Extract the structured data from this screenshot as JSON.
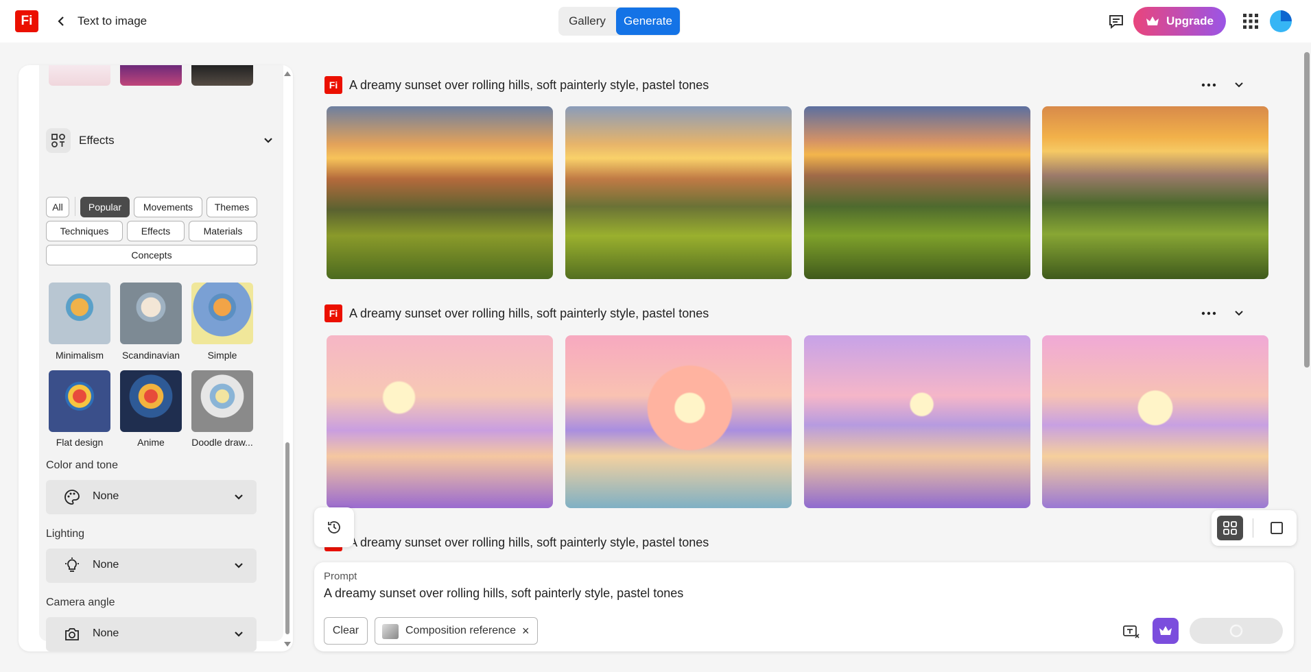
{
  "app": {
    "logo_text": "Fi",
    "page_title": "Text to image"
  },
  "header": {
    "gallery_label": "Gallery",
    "generate_label": "Generate",
    "upgrade_label": "Upgrade",
    "accent": "#1473e6"
  },
  "sidebar": {
    "effects": {
      "title": "Effects",
      "filter_chips": [
        "All",
        "Popular",
        "Movements",
        "Themes",
        "Techniques",
        "Effects",
        "Materials",
        "Concepts"
      ],
      "active_chip": "Popular",
      "styles": [
        "Minimalism",
        "Scandinavian",
        "Simple",
        "Flat design",
        "Anime",
        "Doodle draw..."
      ]
    },
    "color_tone": {
      "label": "Color and tone",
      "value": "None"
    },
    "lighting": {
      "label": "Lighting",
      "value": "None"
    },
    "camera_angle": {
      "label": "Camera angle",
      "value": "None"
    }
  },
  "generations": [
    {
      "prompt": "A dreamy sunset over rolling hills, soft painterly style, pastel tones",
      "style": "photographic"
    },
    {
      "prompt": "A dreamy sunset over rolling hills, soft painterly style, pastel tones",
      "style": "pastel-illustration"
    },
    {
      "prompt": "A dreamy sunset over rolling hills, soft painterly style, pastel tones",
      "style": "partial"
    }
  ],
  "prompt_panel": {
    "label": "Prompt",
    "text": "A dreamy sunset over rolling hills, soft painterly style, pastel tones",
    "clear_label": "Clear",
    "composition_label": "Composition reference",
    "close_glyph": "×"
  }
}
